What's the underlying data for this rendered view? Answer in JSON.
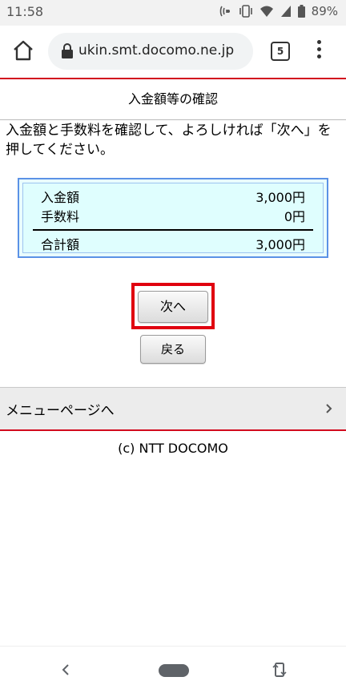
{
  "status_bar": {
    "time": "11:58",
    "battery": "89%",
    "icons": [
      "nfc-icon",
      "vibrate-icon",
      "wifi-icon",
      "signal-icon",
      "battery-icon"
    ]
  },
  "browser": {
    "url": "ukin.smt.docomo.ne.jp",
    "tab_count": "5"
  },
  "page": {
    "title": "入金額等の確認",
    "instruction": "入金額と手数料を確認して、よろしければ「次へ」を押してください。",
    "summary": {
      "rows": [
        {
          "label": "入金額",
          "value": "3,000円"
        },
        {
          "label": "手数料",
          "value": "0円"
        }
      ],
      "total": {
        "label": "合計額",
        "value": "3,000円"
      }
    },
    "next_label": "次へ",
    "back_label": "戻る",
    "menu_link": "メニューページへ",
    "footer": "(c) NTT DOCOMO"
  },
  "colors": {
    "accent_red": "#d20a1e",
    "box_border": "#5b92e6",
    "box_bg": "#dffefe"
  }
}
